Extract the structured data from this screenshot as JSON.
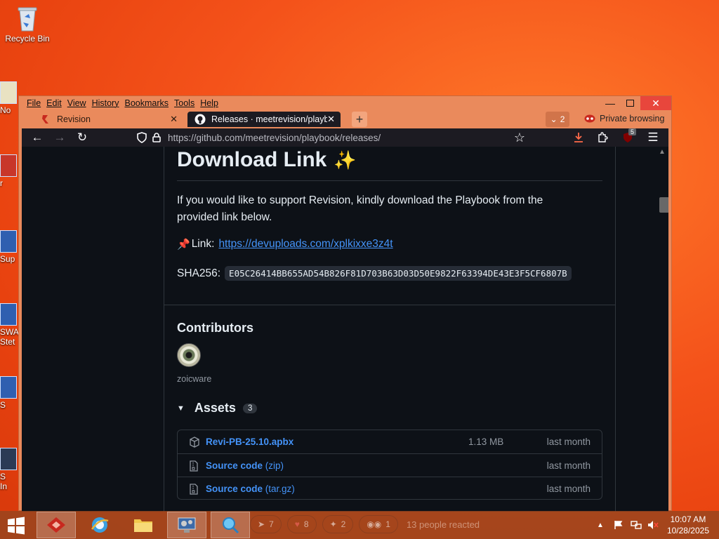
{
  "desktop": {
    "recycle_bin": "Recycle Bin",
    "partial_labels": [
      "No",
      "r",
      "Sup",
      "SWA",
      "Stet",
      "S",
      "S",
      "In"
    ]
  },
  "browser": {
    "menu": [
      "File",
      "Edit",
      "View",
      "History",
      "Bookmarks",
      "Tools",
      "Help"
    ],
    "tabs": [
      {
        "title": "Revision",
        "active": false
      },
      {
        "title": "Releases · meetrevision/playboc",
        "active": true
      }
    ],
    "tab_count": "2",
    "private_label": "Private browsing",
    "url_host": "https://github.com",
    "url_path": "/meetrevision/playbook/releases/",
    "extension_badge": "5"
  },
  "page": {
    "heading": "Download Link",
    "heading_emoji": "✨",
    "paragraph": "If you would like to support Revision, kindly download the Playbook from the provided link below.",
    "link_prefix": "Link:",
    "link_url": "https://devuploads.com/xplkixxe3z4t",
    "sha_label": "SHA256:",
    "sha_value": "E05C26414BB655AD54B826F81D703B63D03D50E9822F63394DE43E3F5CF6807B",
    "contributors_heading": "Contributors",
    "contributor_name": "zoicware",
    "assets_heading": "Assets",
    "assets_count": "3",
    "assets": [
      {
        "name": "Revi-PB-25.10.apbx",
        "suffix": "",
        "size": "1.13 MB",
        "date": "last month"
      },
      {
        "name": "Source code",
        "suffix": "(zip)",
        "size": "",
        "date": "last month"
      },
      {
        "name": "Source code",
        "suffix": "(tar.gz)",
        "size": "",
        "date": "last month"
      }
    ],
    "reactions": [
      {
        "count": "7"
      },
      {
        "count": "8"
      },
      {
        "count": "2"
      },
      {
        "count": "1"
      }
    ],
    "reacted_text": "13 people reacted"
  },
  "taskbar": {
    "time": "10:07 AM",
    "date": "10/28/2025"
  }
}
